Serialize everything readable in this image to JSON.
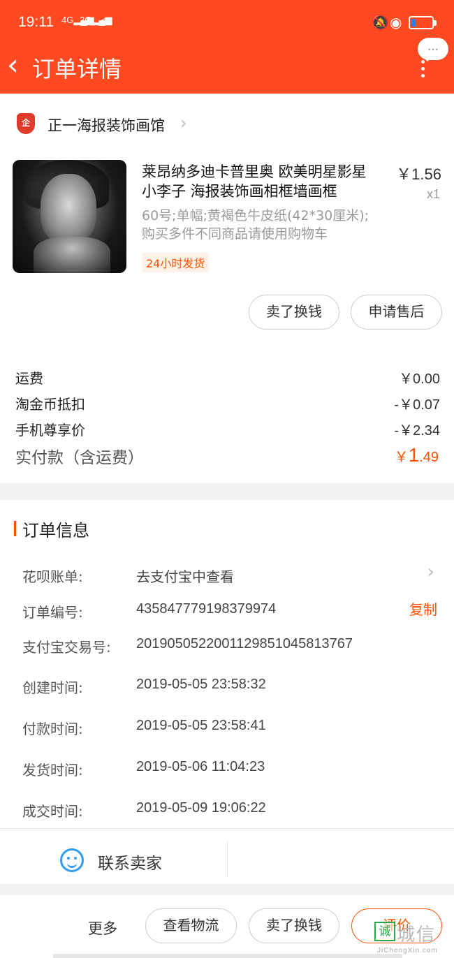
{
  "status_bar": {
    "time": "19:11",
    "sig1": "4G",
    "sig2": "2G",
    "battery_level": 0.2
  },
  "header": {
    "back_glyph": "‹",
    "title": "订单详情",
    "bubble": "…"
  },
  "shop": {
    "logo": "企",
    "name": "正一海报装饰画馆",
    "chevron": "›"
  },
  "product": {
    "title": "莱昂纳多迪卡普里奥 欧美明星影星小李子 海报装饰画相框墙画框",
    "price": "￥1.56",
    "qty": "x1",
    "sku_line1": "60号;单幅;黄褐色牛皮纸(42*30厘米);",
    "sku_line2": "购买多件不同商品请使用购物车",
    "tag": "24小时发货",
    "btn_sell": "卖了换钱",
    "btn_after_sale": "申请售后"
  },
  "fees": {
    "rows": [
      {
        "label": "运费",
        "value": "￥0.00"
      },
      {
        "label": "淘金币抵扣",
        "value": "-￥0.07"
      },
      {
        "label": "手机尊享价",
        "value": "-￥2.34"
      }
    ],
    "total_label": "实付款（含运费）",
    "total_currency": "￥",
    "total_int": "1",
    "total_dec": ".49"
  },
  "order_info": {
    "section_title": "订单信息",
    "rows": [
      {
        "k": "花呗账单:",
        "v": "去支付宝中查看"
      },
      {
        "k": "订单编号:",
        "v": "435847779198379974"
      },
      {
        "k": "支付宝交易号:",
        "v": "2019050522001129851045813767"
      },
      {
        "k": "创建时间:",
        "v": "2019-05-05 23:58:32"
      },
      {
        "k": "付款时间:",
        "v": "2019-05-05 23:58:41"
      },
      {
        "k": "发货时间:",
        "v": "2019-05-06 11:04:23"
      },
      {
        "k": "成交时间:",
        "v": "2019-05-09 19:06:22"
      }
    ],
    "copy_label": "复制",
    "chevron": "›"
  },
  "contact": {
    "label": "联系卖家"
  },
  "bottom_bar": {
    "more": "更多",
    "btn_logistics": "查看物流",
    "btn_sell": "卖了换钱",
    "btn_rate": "评价"
  },
  "watermark": {
    "square": "诚",
    "cn": "城信",
    "en": "JiChengXin.com"
  },
  "colors": {
    "brand": "#ff4a21",
    "accent": "#ff5000",
    "contact_icon": "#2f9cf0"
  }
}
